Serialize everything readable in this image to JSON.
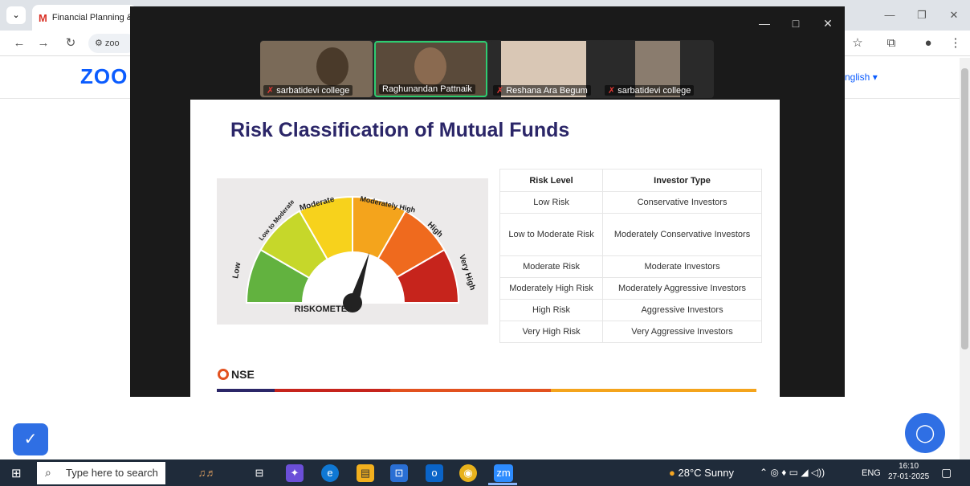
{
  "browser": {
    "tab_title": "Financial Planning &",
    "tab_icon": "M",
    "address_text": "zoo",
    "dropdown_glyph": "⌄"
  },
  "zoom_page": {
    "logo": "ZOO",
    "language": "nglish ▾"
  },
  "meeting": {
    "participants": [
      {
        "name": "sarbatidevi college",
        "muted": true,
        "bg": "#7a6a58"
      },
      {
        "name": "Raghunandan Pattnaik",
        "muted": false,
        "bg": "#5a4a3a"
      },
      {
        "name": "Reshana Ara Begum",
        "muted": true,
        "bg": "#d9c7b5"
      },
      {
        "name": "sarbatidevi college",
        "muted": true,
        "bg": "#8a7c6e"
      }
    ],
    "window_controls": [
      "—",
      "□",
      "✕"
    ]
  },
  "slide": {
    "title": "Risk Classification of Mutual Funds",
    "gauge": {
      "segments": [
        "Low",
        "Low to Moderate",
        "Moderate",
        "Moderately High",
        "High",
        "Very High"
      ],
      "colors": [
        "#62b23f",
        "#c6d72a",
        "#f7d21c",
        "#f4a41c",
        "#ef6a1e",
        "#c6241c"
      ],
      "needle_level": "Moderately High",
      "label": "RISKOMETER"
    },
    "table": {
      "headers": [
        "Risk Level",
        "Investor Type"
      ],
      "rows": [
        [
          "Low Risk",
          "Conservative Investors"
        ],
        [
          "Low to Moderate Risk",
          "Moderately Conservative Investors"
        ],
        [
          "Moderate Risk",
          "Moderate Investors"
        ],
        [
          "Moderately High Risk",
          "Moderately Aggressive Investors"
        ],
        [
          "High Risk",
          "Aggressive Investors"
        ],
        [
          "Very High Risk",
          "Very Aggressive Investors"
        ]
      ]
    },
    "footer_logo": "NSE",
    "band_colors": [
      "#2b2668",
      "#c6241c",
      "#e2511f",
      "#f4a41c"
    ]
  },
  "taskbar": {
    "search_placeholder": "Type here to search",
    "weather": "28°C  Sunny",
    "language": "ENG",
    "time": "16:10",
    "date": "27-01-2025"
  }
}
